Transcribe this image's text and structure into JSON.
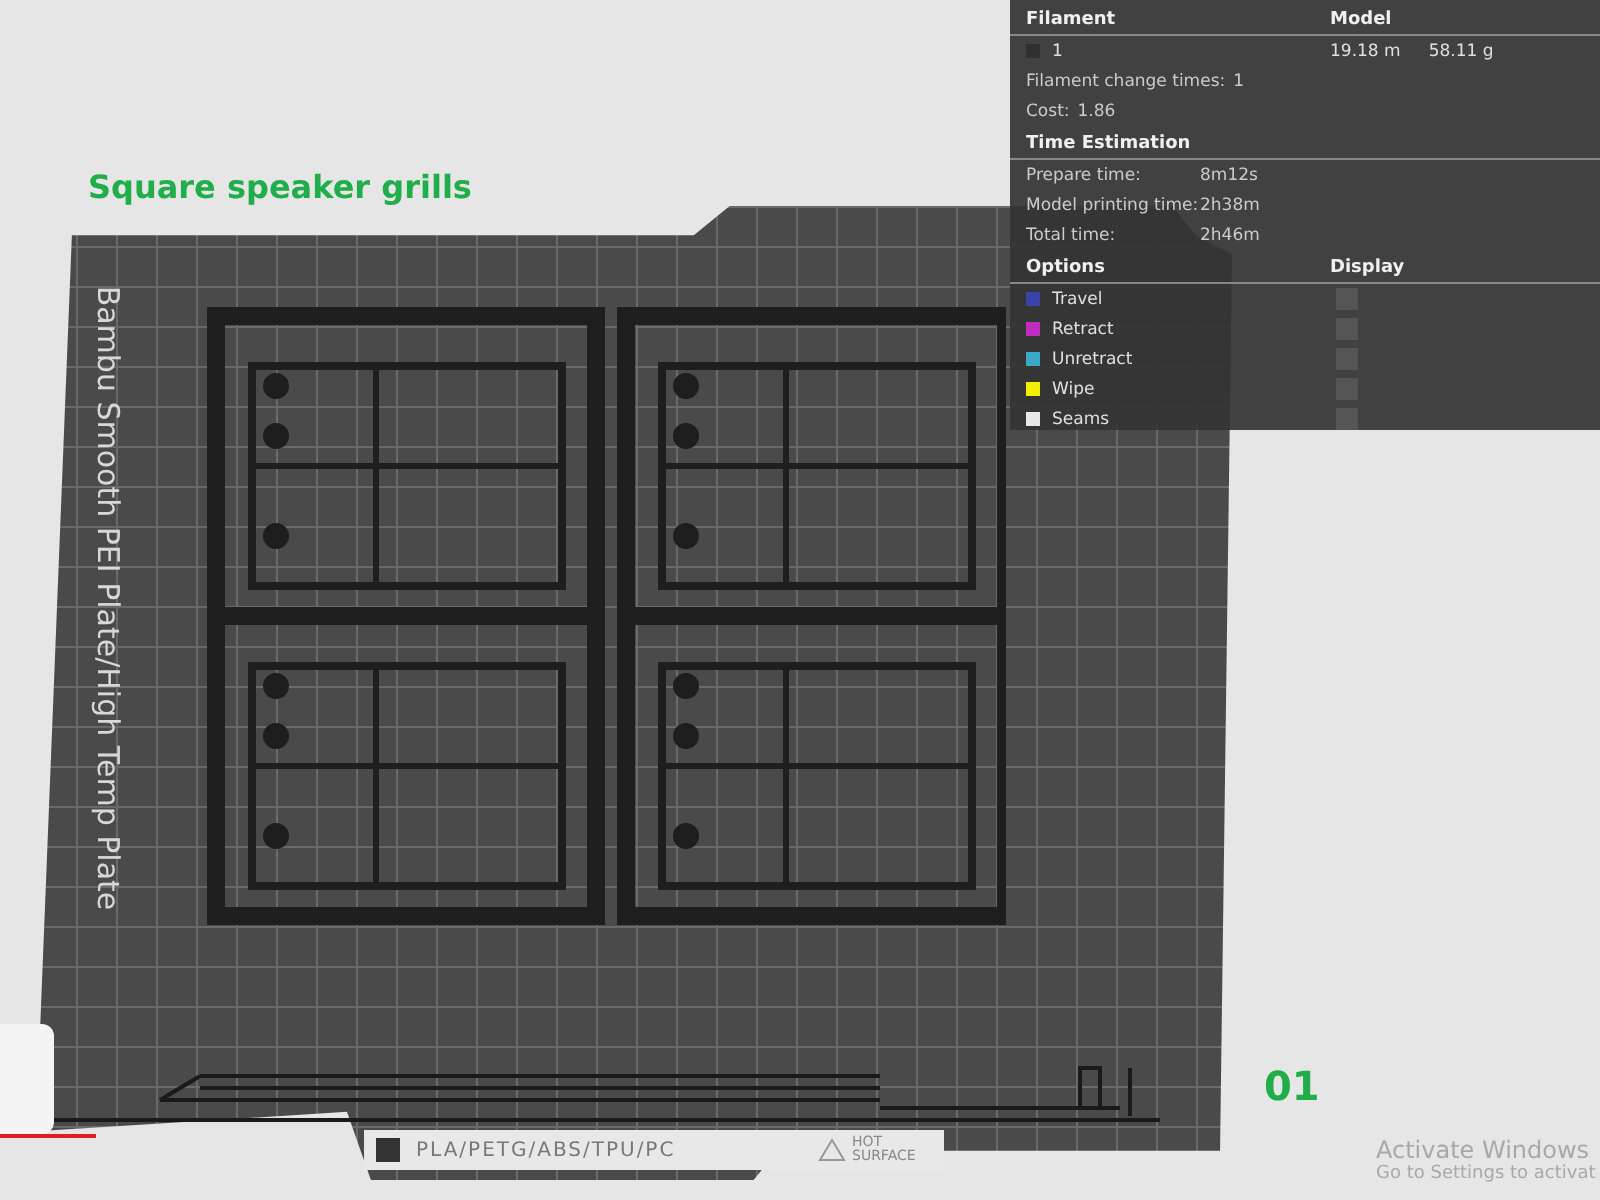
{
  "scene_title": "Square speaker grills",
  "plate": {
    "name": "Bambu Smooth PEI Plate/High Temp Plate",
    "materials": "PLA/PETG/ABS/TPU/PC",
    "warning": "HOT SURFACE",
    "number": "01"
  },
  "stats": {
    "filament_header": "Filament",
    "model_header": "Model",
    "filaments": [
      {
        "id": "1",
        "color": "#303030",
        "length": "19.18 m",
        "weight": "58.11 g"
      }
    ],
    "change_times_label": "Filament change times:",
    "change_times": "1",
    "cost_label": "Cost:",
    "cost": "1.86"
  },
  "time": {
    "title": "Time Estimation",
    "rows": [
      {
        "label": "Prepare time:",
        "value": "8m12s"
      },
      {
        "label": "Model printing time:",
        "value": "2h38m"
      },
      {
        "label": "Total time:",
        "value": "2h46m"
      }
    ]
  },
  "options": {
    "title": "Options",
    "display_header": "Display",
    "items": [
      {
        "label": "Travel",
        "color": "#3a44a8",
        "checked": false
      },
      {
        "label": "Retract",
        "color": "#c02cc0",
        "checked": false
      },
      {
        "label": "Unretract",
        "color": "#3aa8c8",
        "checked": false
      },
      {
        "label": "Wipe",
        "color": "#f0f000",
        "checked": false
      },
      {
        "label": "Seams",
        "color": "#e8e8e8",
        "checked": false
      }
    ]
  },
  "os_notice": {
    "title": "Activate Windows",
    "subtitle": "Go to Settings to activat"
  }
}
